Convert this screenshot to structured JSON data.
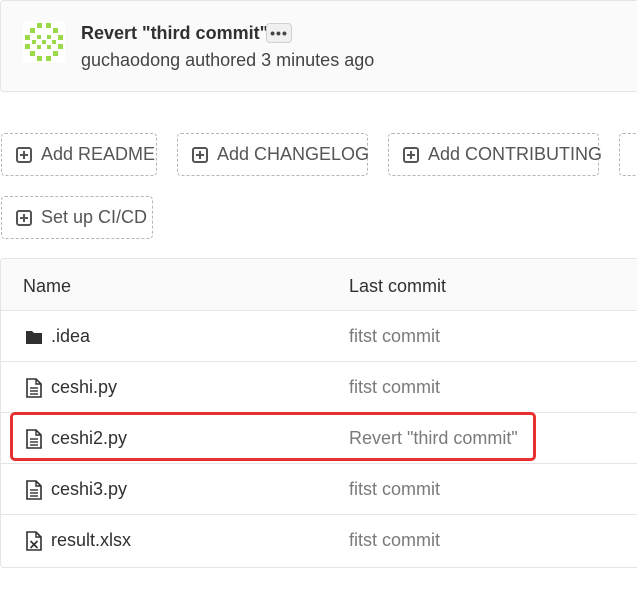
{
  "commit": {
    "title": "Revert \"third commit\"",
    "more_label": "•••",
    "meta": "guchaodong authored 3 minutes ago"
  },
  "suggestions": [
    {
      "label": "Add README"
    },
    {
      "label": "Add CHANGELOG"
    },
    {
      "label": "Add CONTRIBUTING"
    },
    {
      "label": "Set up CI/CD"
    }
  ],
  "table": {
    "headers": {
      "name": "Name",
      "last_commit": "Last commit"
    },
    "rows": [
      {
        "name": ".idea",
        "icon": "folder-icon",
        "last_commit": "fitst commit"
      },
      {
        "name": "ceshi.py",
        "icon": "file-icon",
        "last_commit": "fitst commit"
      },
      {
        "name": "ceshi2.py",
        "icon": "file-icon",
        "last_commit": "Revert \"third commit\""
      },
      {
        "name": "ceshi3.py",
        "icon": "file-icon",
        "last_commit": "fitst commit"
      },
      {
        "name": "result.xlsx",
        "icon": "spreadsheet-file-icon",
        "last_commit": "fitst commit"
      }
    ]
  },
  "colors": {
    "highlight": "#e8312f",
    "avatar": "#9bd84a"
  }
}
